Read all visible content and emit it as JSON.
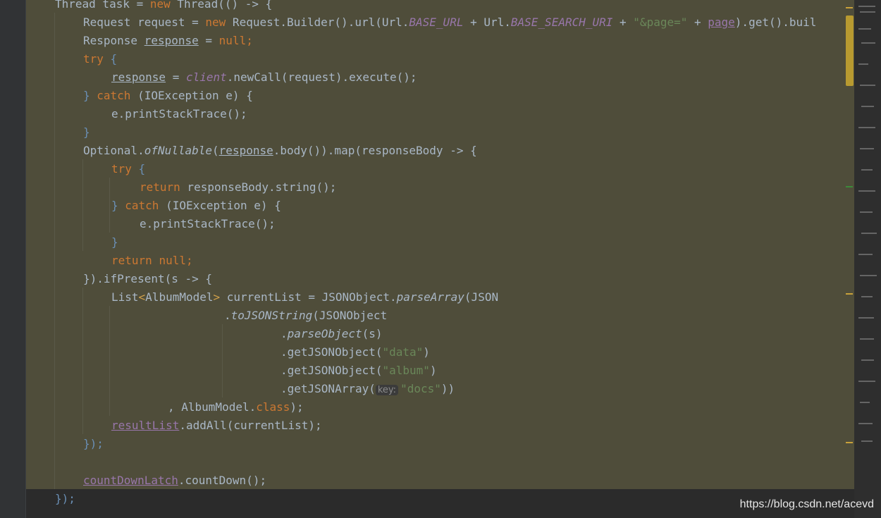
{
  "colors": {
    "editor_bg": "#2b2b2b",
    "highlight_bg": "#4f4d3a",
    "keyword": "#cc7832",
    "string": "#6a8759",
    "field": "#9876aa",
    "default": "#a9b7c6"
  },
  "code": {
    "l0_a": "Thread task = ",
    "l0_kw": "new",
    "l0_b": " Thread(() -> {",
    "l1_a": "Request request = ",
    "l1_kw": "new",
    "l1_b": " Request.Builder().url(Url.",
    "l1_f1": "BASE_URL",
    "l1_c": " + Url.",
    "l1_f2": "BASE_SEARCH_URI",
    "l1_d": " + ",
    "l1_str": "\"&page=\"",
    "l1_e": " + ",
    "l1_page": "page",
    "l1_f": ").get().buil",
    "l2_a": "Response ",
    "l2_resp": "response",
    "l2_b": " = ",
    "l2_kw": "null",
    "l2_c": ";",
    "l3_kw": "try",
    "l3_b": " {",
    "l4_resp": "response",
    "l4_a": " = ",
    "l4_client": "client",
    "l4_b": ".newCall(request).execute();",
    "l5_a": "} ",
    "l5_kw": "catch",
    "l5_b": " (IOException e) {",
    "l6": "e.printStackTrace();",
    "l7": "}",
    "l8_a": "Optional.",
    "l8_m": "ofNullable",
    "l8_b": "(",
    "l8_resp": "response",
    "l8_c": ".body()).map(responseBody -> {",
    "l9_kw": "try",
    "l9_b": " {",
    "l10_kw": "return",
    "l10_b": " responseBody.string();",
    "l11_a": "} ",
    "l11_kw": "catch",
    "l11_b": " (IOException e) {",
    "l12": "e.printStackTrace();",
    "l13": "}",
    "l14_kw": "return",
    "l14_b": " ",
    "l14_null": "null",
    "l14_c": ";",
    "l15": "}).ifPresent(s -> {",
    "l16_a": "List",
    "l16_lt": "<",
    "l16_b": "AlbumModel",
    "l16_gt": ">",
    "l16_c": " currentList = JSONObject.",
    "l16_m": "parseArray",
    "l16_d": "(JSON",
    "l17_a": ".",
    "l17_m": "toJSONString",
    "l17_b": "(JSONObject",
    "l18_a": ".",
    "l18_m": "parseObject",
    "l18_b": "(s)",
    "l19_a": ".getJSONObject(",
    "l19_str": "\"data\"",
    "l19_b": ")",
    "l20_a": ".getJSONObject(",
    "l20_str": "\"album\"",
    "l20_b": ")",
    "l21_a": ".getJSONArray(",
    "l21_hint": "key:",
    "l21_str": "\"docs\"",
    "l21_b": "))",
    "l22_a": ", AlbumModel.",
    "l22_kw": "class",
    "l22_b": ");",
    "l23_field": "resultList",
    "l23_b": ".addAll(currentList);",
    "l24": "});",
    "l26_field": "countDownLatch",
    "l26_b": ".countDown();",
    "l27": "});"
  },
  "watermark": "https://blog.csdn.net/acevd"
}
